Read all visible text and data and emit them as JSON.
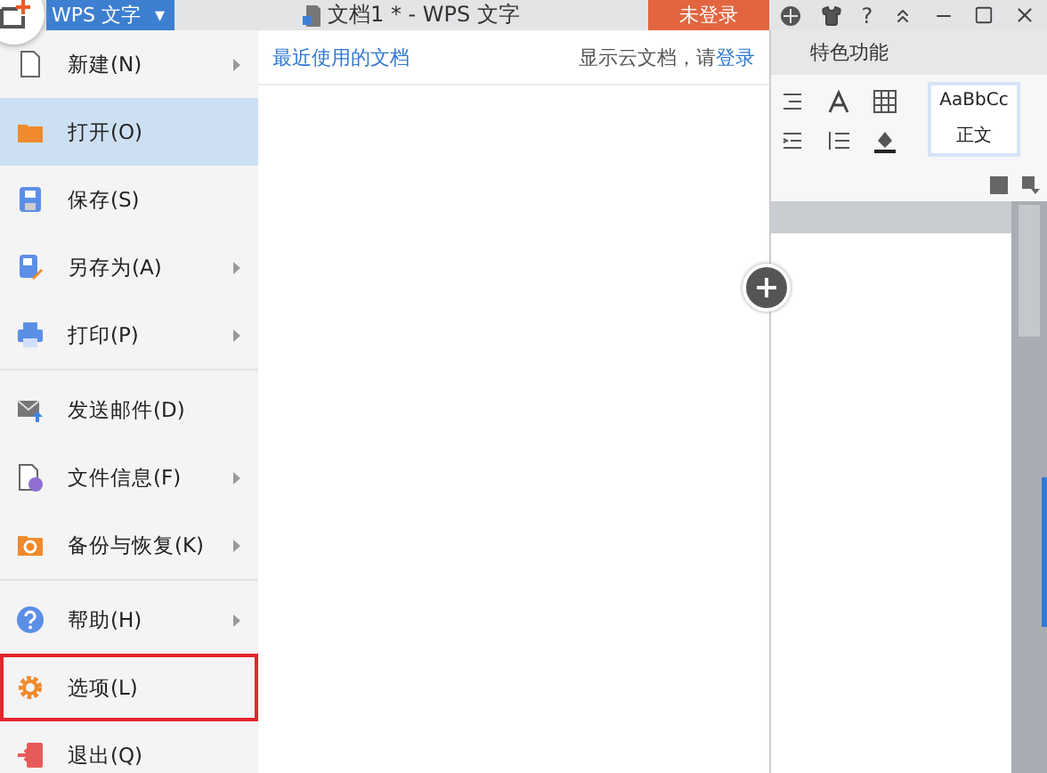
{
  "app_button": {
    "label": "WPS 文字",
    "caret": "▾"
  },
  "title": "文档1 * - WPS 文字",
  "login_button": "未登录",
  "help_button": "?",
  "menu_groups": [
    [
      {
        "label": "新建(N)",
        "submenu": true,
        "selected": false,
        "outlined": false
      },
      {
        "label": "打开(O)",
        "submenu": false,
        "selected": true,
        "outlined": false
      },
      {
        "label": "保存(S)",
        "submenu": false,
        "selected": false,
        "outlined": false
      },
      {
        "label": "另存为(A)",
        "submenu": true,
        "selected": false,
        "outlined": false
      },
      {
        "label": "打印(P)",
        "submenu": true,
        "selected": false,
        "outlined": false
      }
    ],
    [
      {
        "label": "发送邮件(D)",
        "submenu": false,
        "selected": false,
        "outlined": false
      },
      {
        "label": "文件信息(F)",
        "submenu": true,
        "selected": false,
        "outlined": false
      },
      {
        "label": "备份与恢复(K)",
        "submenu": true,
        "selected": false,
        "outlined": false
      }
    ],
    [
      {
        "label": "帮助(H)",
        "submenu": true,
        "selected": false,
        "outlined": false
      },
      {
        "label": "选项(L)",
        "submenu": false,
        "selected": false,
        "outlined": true
      },
      {
        "label": "退出(Q)",
        "submenu": false,
        "selected": false,
        "outlined": false
      }
    ]
  ],
  "recent": {
    "heading": "最近使用的文档",
    "cloud_prompt": "显示云文档，请",
    "login_link": "登录"
  },
  "ribbon": {
    "tab": "特色功能",
    "style_sample": "AaBbCc",
    "style_name": "正文"
  }
}
